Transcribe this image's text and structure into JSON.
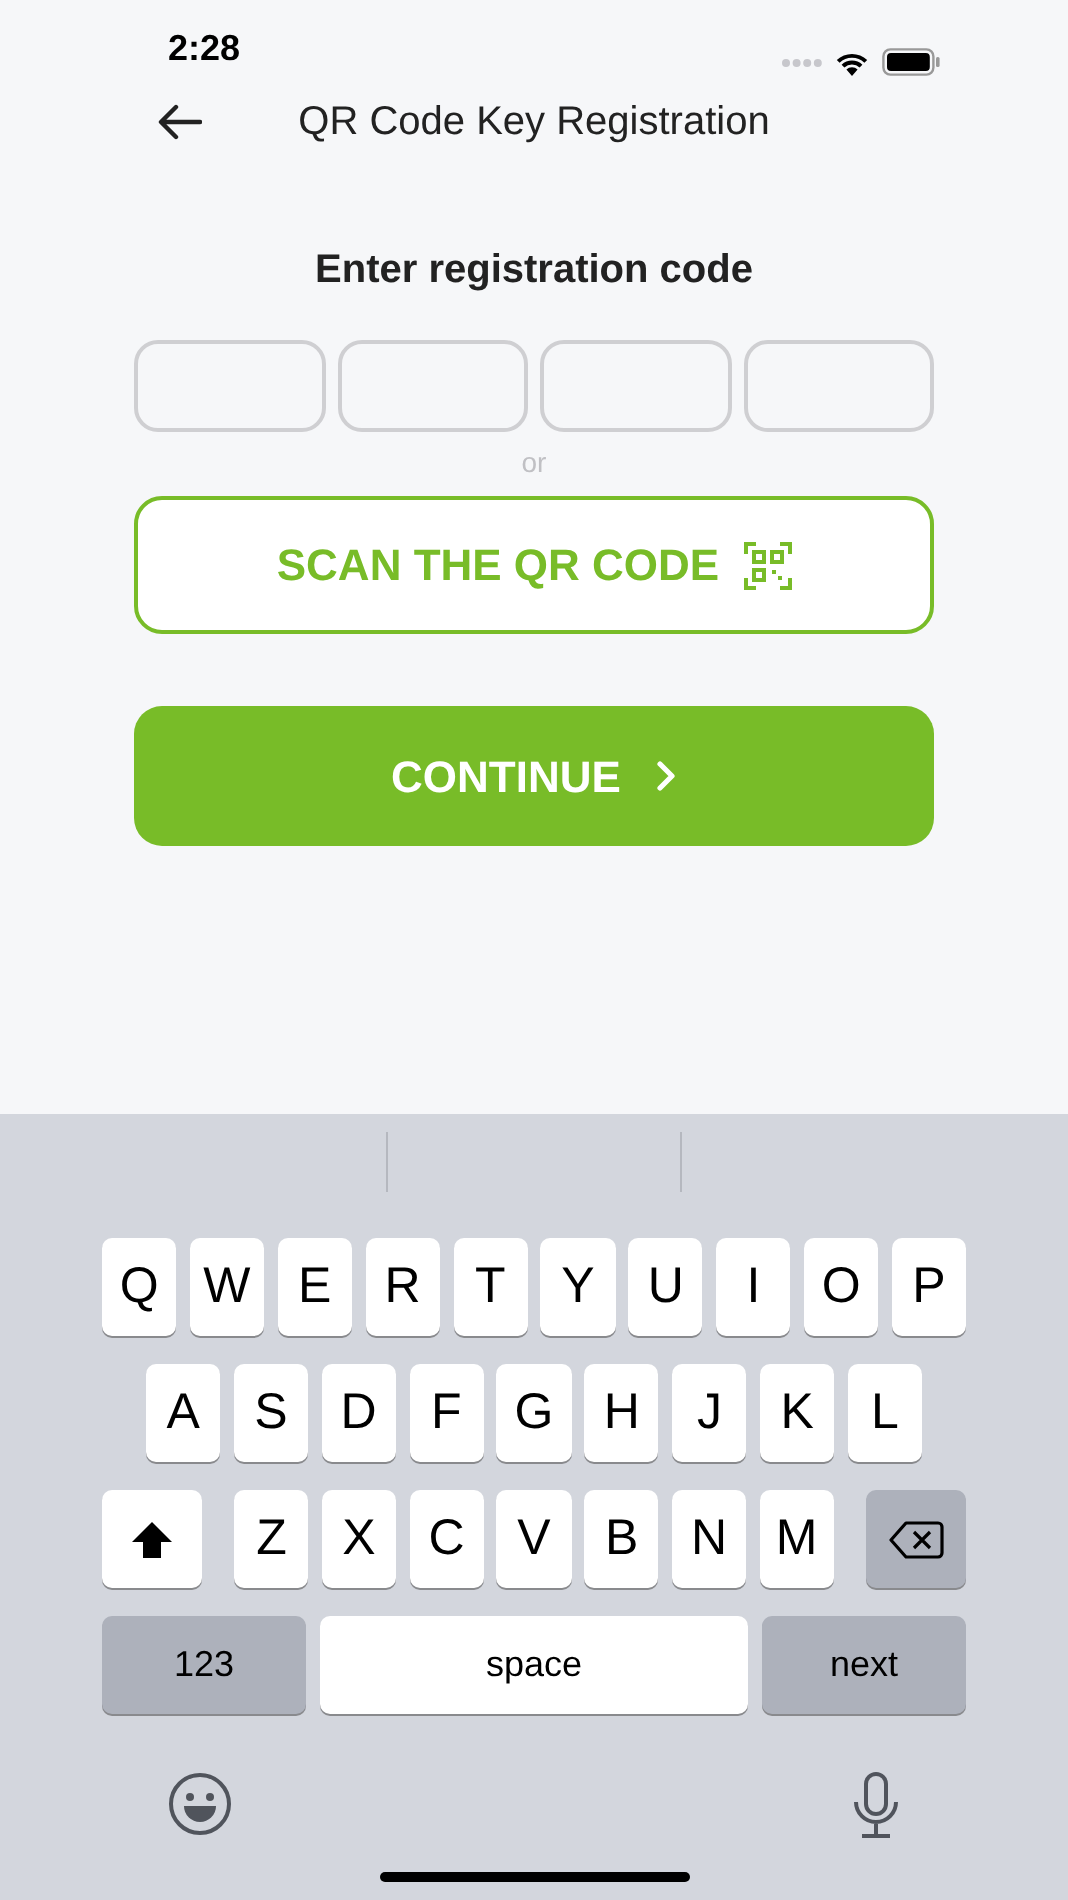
{
  "status_bar": {
    "time": "2:28"
  },
  "nav": {
    "title": "QR Code Key Registration"
  },
  "form": {
    "heading": "Enter registration code",
    "code_fields": [
      {
        "kind": "box"
      },
      {
        "kind": "box"
      },
      {
        "kind": "box"
      },
      {
        "kind": "box"
      }
    ],
    "separator": "or",
    "scan_button": {
      "label": "SCAN THE QR CODE"
    },
    "continue_button": {
      "label": "CONTINUE"
    }
  },
  "keyboard": {
    "rows": [
      [
        {
          "kind": "letter",
          "label": "Q"
        },
        {
          "kind": "letter",
          "label": "W"
        },
        {
          "kind": "letter",
          "label": "E"
        },
        {
          "kind": "letter",
          "label": "R"
        },
        {
          "kind": "letter",
          "label": "T"
        },
        {
          "kind": "letter",
          "label": "Y"
        },
        {
          "kind": "letter",
          "label": "U"
        },
        {
          "kind": "letter",
          "label": "I"
        },
        {
          "kind": "letter",
          "label": "O"
        },
        {
          "kind": "letter",
          "label": "P"
        }
      ],
      [
        {
          "kind": "letter",
          "label": "A"
        },
        {
          "kind": "letter",
          "label": "S"
        },
        {
          "kind": "letter",
          "label": "D"
        },
        {
          "kind": "letter",
          "label": "F"
        },
        {
          "kind": "letter",
          "label": "G"
        },
        {
          "kind": "letter",
          "label": "H"
        },
        {
          "kind": "letter",
          "label": "J"
        },
        {
          "kind": "letter",
          "label": "K"
        },
        {
          "kind": "letter",
          "label": "L"
        }
      ],
      [
        {
          "kind": "shift"
        },
        {
          "kind": "letter",
          "label": "Z"
        },
        {
          "kind": "letter",
          "label": "X"
        },
        {
          "kind": "letter",
          "label": "C"
        },
        {
          "kind": "letter",
          "label": "V"
        },
        {
          "kind": "letter",
          "label": "B"
        },
        {
          "kind": "letter",
          "label": "N"
        },
        {
          "kind": "letter",
          "label": "M"
        },
        {
          "kind": "delete"
        }
      ]
    ],
    "bottom_row": {
      "numbers_key": "123",
      "space_key": "space",
      "return_key": "next"
    }
  }
}
